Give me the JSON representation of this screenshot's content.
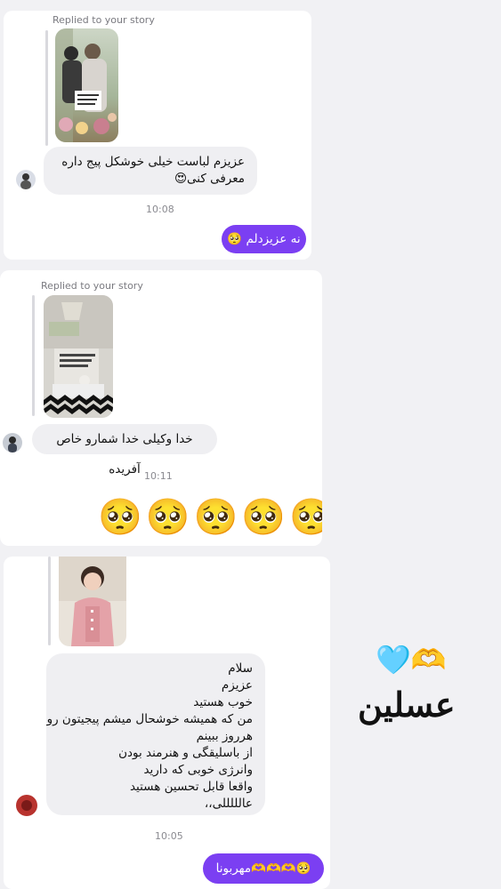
{
  "conversation_1": {
    "replied_label": "Replied to your story",
    "incoming_message": "عزیزم لباست خیلی خوشکل پیج داره معرفی کنی😍",
    "timestamp": "10:08",
    "outgoing_message": "نه عزیزدلم 🥺"
  },
  "conversation_2": {
    "replied_label": "Replied to your story",
    "incoming_message": "خدا وکیلی خدا شمارو خاص آفریده",
    "timestamp": "10:11",
    "outgoing_emojis": "🥺🥺🥺🥺🥺"
  },
  "conversation_3": {
    "incoming_lines": [
      "سلام",
      "عزیزم",
      "خوب هستید",
      "من که همیشه خوشحال میشم پیجیتون رو",
      "هرروز ببینم",
      "از باسلیقگی و هنرمند بودن",
      "وانرژی خوبی که دارید",
      "واقعا قابل تحسین هستید",
      "عالللللی،،"
    ],
    "timestamp": "10:05",
    "outgoing_message": "🥺🫶🫶🫶مهربونا"
  },
  "decoration": {
    "emojis": "🩵🫶",
    "caption": "عسلین"
  },
  "colors": {
    "outgoing_bubble": "#7b3ff2",
    "incoming_bubble": "#efeff2",
    "background": "#f1f1f4"
  }
}
